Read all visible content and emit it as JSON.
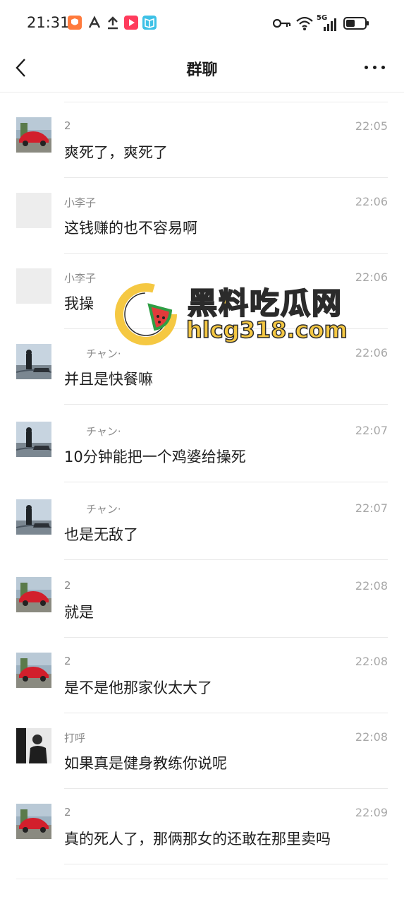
{
  "status_bar": {
    "time": "21:31",
    "left_icons": [
      "shield-app-icon",
      "a-app-icon",
      "upload-icon",
      "video-app-icon",
      "book-app-icon"
    ],
    "right_icons": [
      "key-icon",
      "wifi-icon",
      "5g-signal-icon",
      "battery-icon"
    ],
    "network_label": "5G"
  },
  "header": {
    "title": "群聊",
    "back_icon": "chevron-left-icon",
    "more_icon": "more-dots-icon"
  },
  "watermark": {
    "title": "黑料吃瓜网",
    "url": "hlcg318.com"
  },
  "messages": [
    {
      "name": "2",
      "time": "22:05",
      "text": "爽死了，爽死了",
      "avatar": "car"
    },
    {
      "name": "小李子",
      "time": "22:06",
      "text": "这钱赚的也不容易啊",
      "avatar": "blank"
    },
    {
      "name": "小李子",
      "time": "22:06",
      "text": "我操",
      "avatar": "blank"
    },
    {
      "name": "チャン·",
      "time": "22:06",
      "text": "并且是快餐嘛",
      "avatar": "person-car"
    },
    {
      "name": "チャン·",
      "time": "22:07",
      "text": "10分钟能把一个鸡婆给操死",
      "avatar": "person-car"
    },
    {
      "name": "チャン·",
      "time": "22:07",
      "text": "也是无敌了",
      "avatar": "person-car"
    },
    {
      "name": "2",
      "time": "22:08",
      "text": "就是",
      "avatar": "car"
    },
    {
      "name": "2",
      "time": "22:08",
      "text": "是不是他那家伙太大了",
      "avatar": "car"
    },
    {
      "name": "打呼",
      "time": "22:08",
      "text": "如果真是健身教练你说呢",
      "avatar": "person"
    },
    {
      "name": "2",
      "time": "22:09",
      "text": "真的死人了，那俩那女的还敢在那里卖吗",
      "avatar": "car"
    }
  ]
}
